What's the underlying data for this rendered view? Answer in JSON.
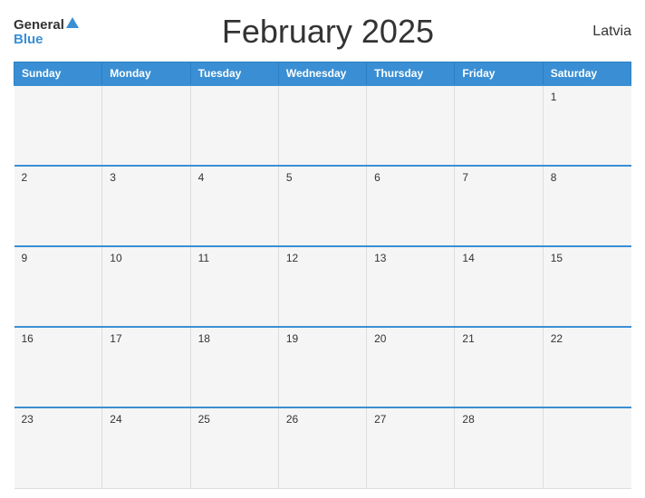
{
  "header": {
    "logo_general": "General",
    "logo_blue": "Blue",
    "title": "February 2025",
    "country": "Latvia"
  },
  "days_of_week": [
    "Sunday",
    "Monday",
    "Tuesday",
    "Wednesday",
    "Thursday",
    "Friday",
    "Saturday"
  ],
  "weeks": [
    [
      null,
      null,
      null,
      null,
      null,
      null,
      1
    ],
    [
      2,
      3,
      4,
      5,
      6,
      7,
      8
    ],
    [
      9,
      10,
      11,
      12,
      13,
      14,
      15
    ],
    [
      16,
      17,
      18,
      19,
      20,
      21,
      22
    ],
    [
      23,
      24,
      25,
      26,
      27,
      28,
      null
    ]
  ]
}
